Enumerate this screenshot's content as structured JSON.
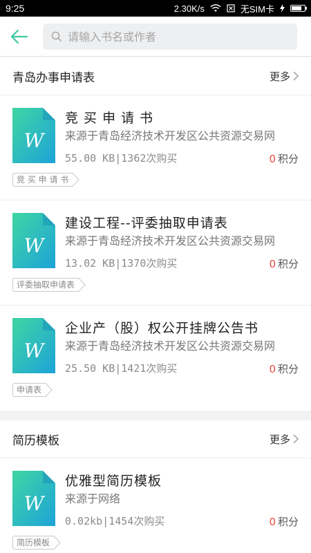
{
  "status_bar": {
    "time": "9:25",
    "speed": "2.30K/s",
    "sim": "无SIM卡"
  },
  "search": {
    "placeholder": "请输入书名或作者"
  },
  "sections": [
    {
      "title": "青岛办事申请表",
      "more": "更多",
      "items": [
        {
          "title": "竞 买 申 请 书",
          "source": "来源于青岛经济技术开发区公共资源交易网",
          "meta": "55.00 KB|1362次购买",
          "points": "0",
          "points_label": "积分",
          "tag": "竞 买 申 请 书"
        },
        {
          "title": "建设工程--评委抽取申请表",
          "source": "来源于青岛经济技术开发区公共资源交易网",
          "meta": "13.02 KB|1370次购买",
          "points": "0",
          "points_label": "积分",
          "tag": "评委抽取申请表"
        },
        {
          "title": "企业产（股）权公开挂牌公告书",
          "source": "来源于青岛经济技术开发区公共资源交易网",
          "meta": "25.50 KB|1421次购买",
          "points": "0",
          "points_label": "积分",
          "tag": "申请表"
        }
      ]
    },
    {
      "title": "简历模板",
      "more": "更多",
      "items": [
        {
          "title": "优雅型简历模板",
          "source": "来源于网络",
          "meta": "0.02kb|1454次购买",
          "points": "0",
          "points_label": "积分",
          "tag": "简历模板"
        }
      ]
    }
  ],
  "icons": {
    "doc_letter": "W",
    "accent": "#3cc9a0",
    "doc_gradient_top": "#40d3a4",
    "doc_gradient_bottom": "#1fa6d6"
  }
}
